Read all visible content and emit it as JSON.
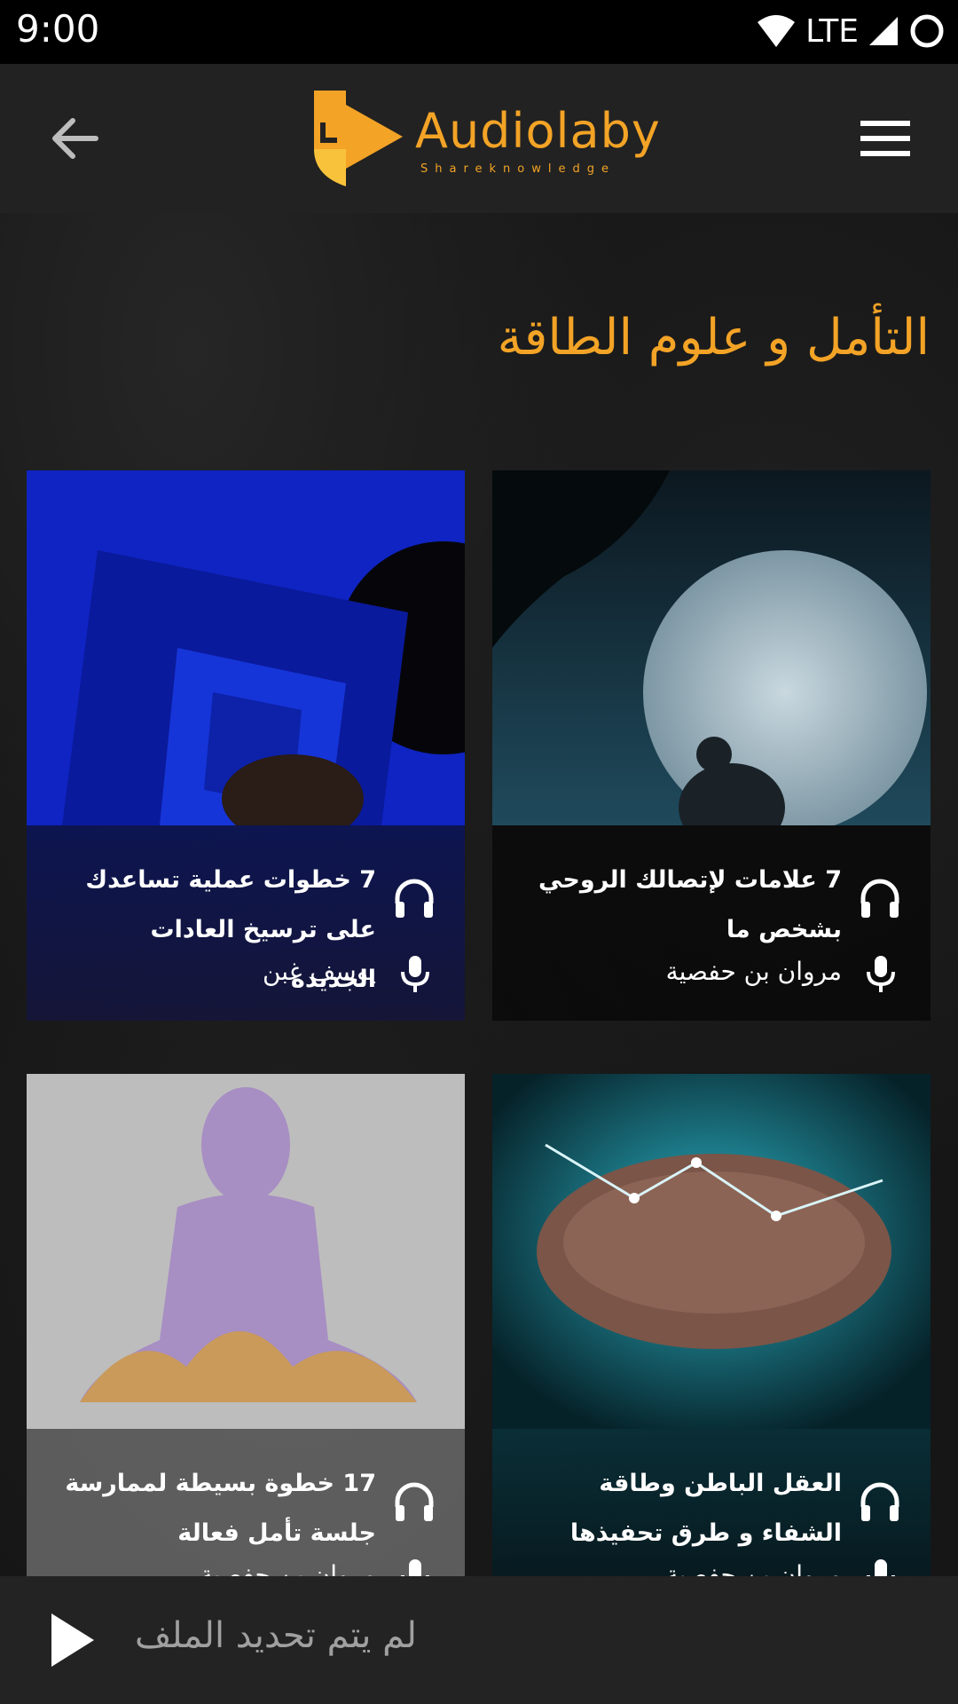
{
  "status_bar": {
    "time": "9:00",
    "network": "LTE"
  },
  "app_bar": {
    "logo_word": "Audiolaby",
    "logo_tagline": "Shareknowledge"
  },
  "section": {
    "title": "التأمل و علوم الطاقة"
  },
  "cards": [
    {
      "title": "7 علامات لإتصالك الروحي بشخص ما",
      "author": "مروان بن حفصية"
    },
    {
      "title": "7 خطوات عملية تساعدك على ترسيخ العادات الجديدة",
      "author": "يوسف غبن"
    },
    {
      "title": "العقل الباطن وطاقة الشفاء و طرق تحفيذها",
      "author": "مروان بن حفصية"
    },
    {
      "title": "17 خطوة بسيطة لممارسة جلسة تأمل فعالة",
      "author": "مروان بن حفصية"
    }
  ],
  "player": {
    "status": "لم يتم تحديد الملف"
  },
  "colors": {
    "accent": "#f3a326",
    "appbar": "#222222",
    "player": "#232323"
  },
  "icons": [
    "back-arrow-icon",
    "menu-icon",
    "headphones-icon",
    "mic-icon",
    "play-icon",
    "wifi-icon",
    "signal-icon",
    "battery-icon"
  ]
}
